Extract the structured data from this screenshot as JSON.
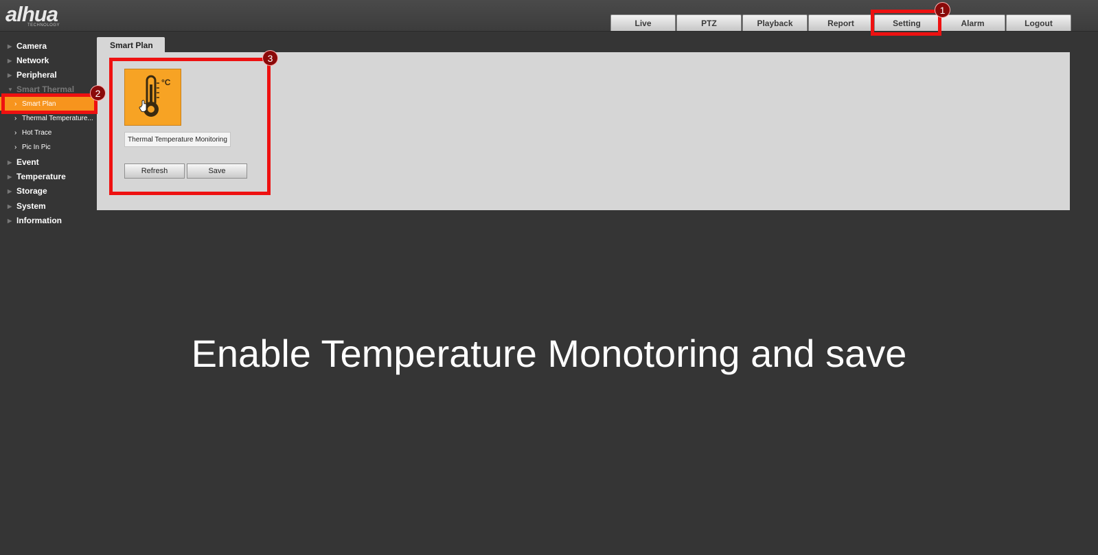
{
  "header": {
    "logo_text": "alhua",
    "logo_sub": "TECHNOLOGY",
    "tabs": [
      {
        "label": "Live"
      },
      {
        "label": "PTZ"
      },
      {
        "label": "Playback"
      },
      {
        "label": "Report"
      },
      {
        "label": "Setting"
      },
      {
        "label": "Alarm"
      },
      {
        "label": "Logout"
      }
    ]
  },
  "sidebar": {
    "items": [
      {
        "label": "Camera"
      },
      {
        "label": "Network"
      },
      {
        "label": "Peripheral"
      },
      {
        "label": "Smart Thermal"
      },
      {
        "label": "Event"
      },
      {
        "label": "Temperature"
      },
      {
        "label": "Storage"
      },
      {
        "label": "System"
      },
      {
        "label": "Information"
      }
    ],
    "sub_items": [
      {
        "label": "Smart Plan"
      },
      {
        "label": "Thermal Temperature..."
      },
      {
        "label": "Hot Trace"
      },
      {
        "label": "Pic In Pic"
      }
    ]
  },
  "main": {
    "tab_label": "Smart Plan",
    "plan_label": "Thermal Temperature Monitoring",
    "icon_unit": "°C",
    "refresh_label": "Refresh",
    "save_label": "Save"
  },
  "annotations": {
    "badges": [
      "1",
      "2",
      "3"
    ],
    "highlight_color": "#ee1111",
    "badge_color": "#8a0a0a"
  },
  "caption": "Enable Temperature Monotoring and save",
  "colors": {
    "active_orange": "#f7941d",
    "icon_orange": "#f7a324",
    "background": "#353535",
    "panel": "#d6d6d6"
  }
}
